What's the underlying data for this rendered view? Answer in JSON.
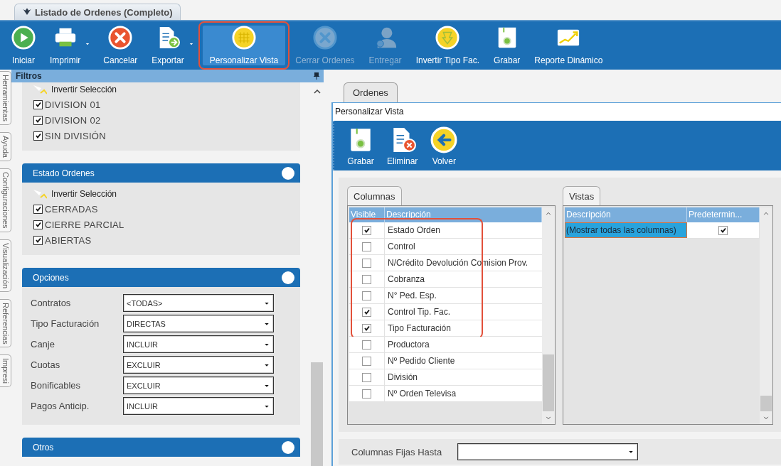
{
  "document_tab": {
    "title": "Listado de Ordenes (Completo)",
    "selected": true
  },
  "toolbar": [
    {
      "label": "Iniciar",
      "disabled": false,
      "selected": false,
      "dropdown": false,
      "callout": false
    },
    {
      "label": "Imprimir",
      "disabled": false,
      "selected": false,
      "dropdown": true,
      "callout": false
    },
    {
      "label": "Cancelar",
      "disabled": false,
      "selected": false,
      "dropdown": false,
      "callout": false
    },
    {
      "label": "Exportar",
      "disabled": false,
      "selected": false,
      "dropdown": true,
      "callout": false
    },
    {
      "label": "Personalizar Vista",
      "disabled": false,
      "selected": true,
      "dropdown": false,
      "callout": true
    },
    {
      "label": "Cerrar Ordenes",
      "disabled": true,
      "selected": false,
      "dropdown": false,
      "callout": false
    },
    {
      "label": "Entregar",
      "disabled": true,
      "selected": false,
      "dropdown": false,
      "callout": false
    },
    {
      "label": "Invertir Tipo Fac.",
      "disabled": false,
      "selected": false,
      "dropdown": false,
      "callout": false
    },
    {
      "label": "Grabar",
      "disabled": false,
      "selected": false,
      "dropdown": false,
      "callout": false
    },
    {
      "label": "Reporte Dinámico",
      "disabled": false,
      "selected": false,
      "dropdown": false,
      "callout": false
    }
  ],
  "side_tabs": [
    "Herramientas",
    "Ayuda",
    "Configuraciones",
    "Visualización",
    "Referencias",
    "Impresi"
  ],
  "filters": {
    "title": "Filtros",
    "groups": [
      {
        "kind": "checklist",
        "invert_label": "Invertir Selección",
        "items": [
          {
            "label": "DIVISION 01",
            "checked": true
          },
          {
            "label": "DIVISION 02",
            "checked": true
          },
          {
            "label": "SIN DIVISIÓN",
            "checked": true
          }
        ]
      },
      {
        "kind": "checklist",
        "title": "Estado Ordenes",
        "invert_label": "Invertir Selección",
        "items": [
          {
            "label": "CERRADAS",
            "checked": true
          },
          {
            "label": "CIERRE PARCIAL",
            "checked": true
          },
          {
            "label": "ABIERTAS",
            "checked": true
          }
        ]
      },
      {
        "kind": "options",
        "title": "Opciones",
        "rows": [
          {
            "label": "Contratos",
            "value": "<TODAS>"
          },
          {
            "label": "Tipo Facturación",
            "value": "DIRECTAS"
          },
          {
            "label": "Canje",
            "value": "INCLUIR"
          },
          {
            "label": "Cuotas",
            "value": "EXCLUIR"
          },
          {
            "label": "Bonificables",
            "value": "EXCLUIR"
          },
          {
            "label": "Pagos Anticip.",
            "value": "INCLUIR"
          }
        ]
      },
      {
        "kind": "header",
        "title": "Otros"
      }
    ]
  },
  "content_tab": {
    "label": "Ordenes",
    "selected": true
  },
  "customize_view": {
    "title": "Personalizar Vista",
    "toolbar": [
      {
        "label": "Grabar"
      },
      {
        "label": "Eliminar"
      },
      {
        "label": "Volver"
      }
    ],
    "columns_panel": {
      "tab": "Columnas",
      "headers": [
        "Visible",
        "Descripción"
      ],
      "rows": [
        {
          "visible": true,
          "description": "Estado Orden",
          "callout": true
        },
        {
          "visible": false,
          "description": "Control",
          "callout": true
        },
        {
          "visible": false,
          "description": "N/Crédito Devolución Comision Prov.",
          "callout": true
        },
        {
          "visible": false,
          "description": "Cobranza",
          "callout": true
        },
        {
          "visible": false,
          "description": "N° Ped. Esp.",
          "callout": true
        },
        {
          "visible": true,
          "description": "Control Tip. Fac.",
          "callout": true
        },
        {
          "visible": true,
          "description": "Tipo Facturación",
          "callout": true
        },
        {
          "visible": false,
          "description": "Productora",
          "callout": false
        },
        {
          "visible": false,
          "description": "Nº Pedido Cliente",
          "callout": false
        },
        {
          "visible": false,
          "description": "División",
          "callout": false
        },
        {
          "visible": false,
          "description": "Nº Orden Televisa",
          "callout": false
        }
      ]
    },
    "views_panel": {
      "tab": "Vistas",
      "headers": [
        "Descripción",
        "Predetermin..."
      ],
      "rows": [
        {
          "description": "(Mostrar todas las columnas)",
          "default": true,
          "selected": true
        }
      ]
    },
    "fixed_columns": {
      "label": "Columnas Fijas Hasta"
    }
  }
}
